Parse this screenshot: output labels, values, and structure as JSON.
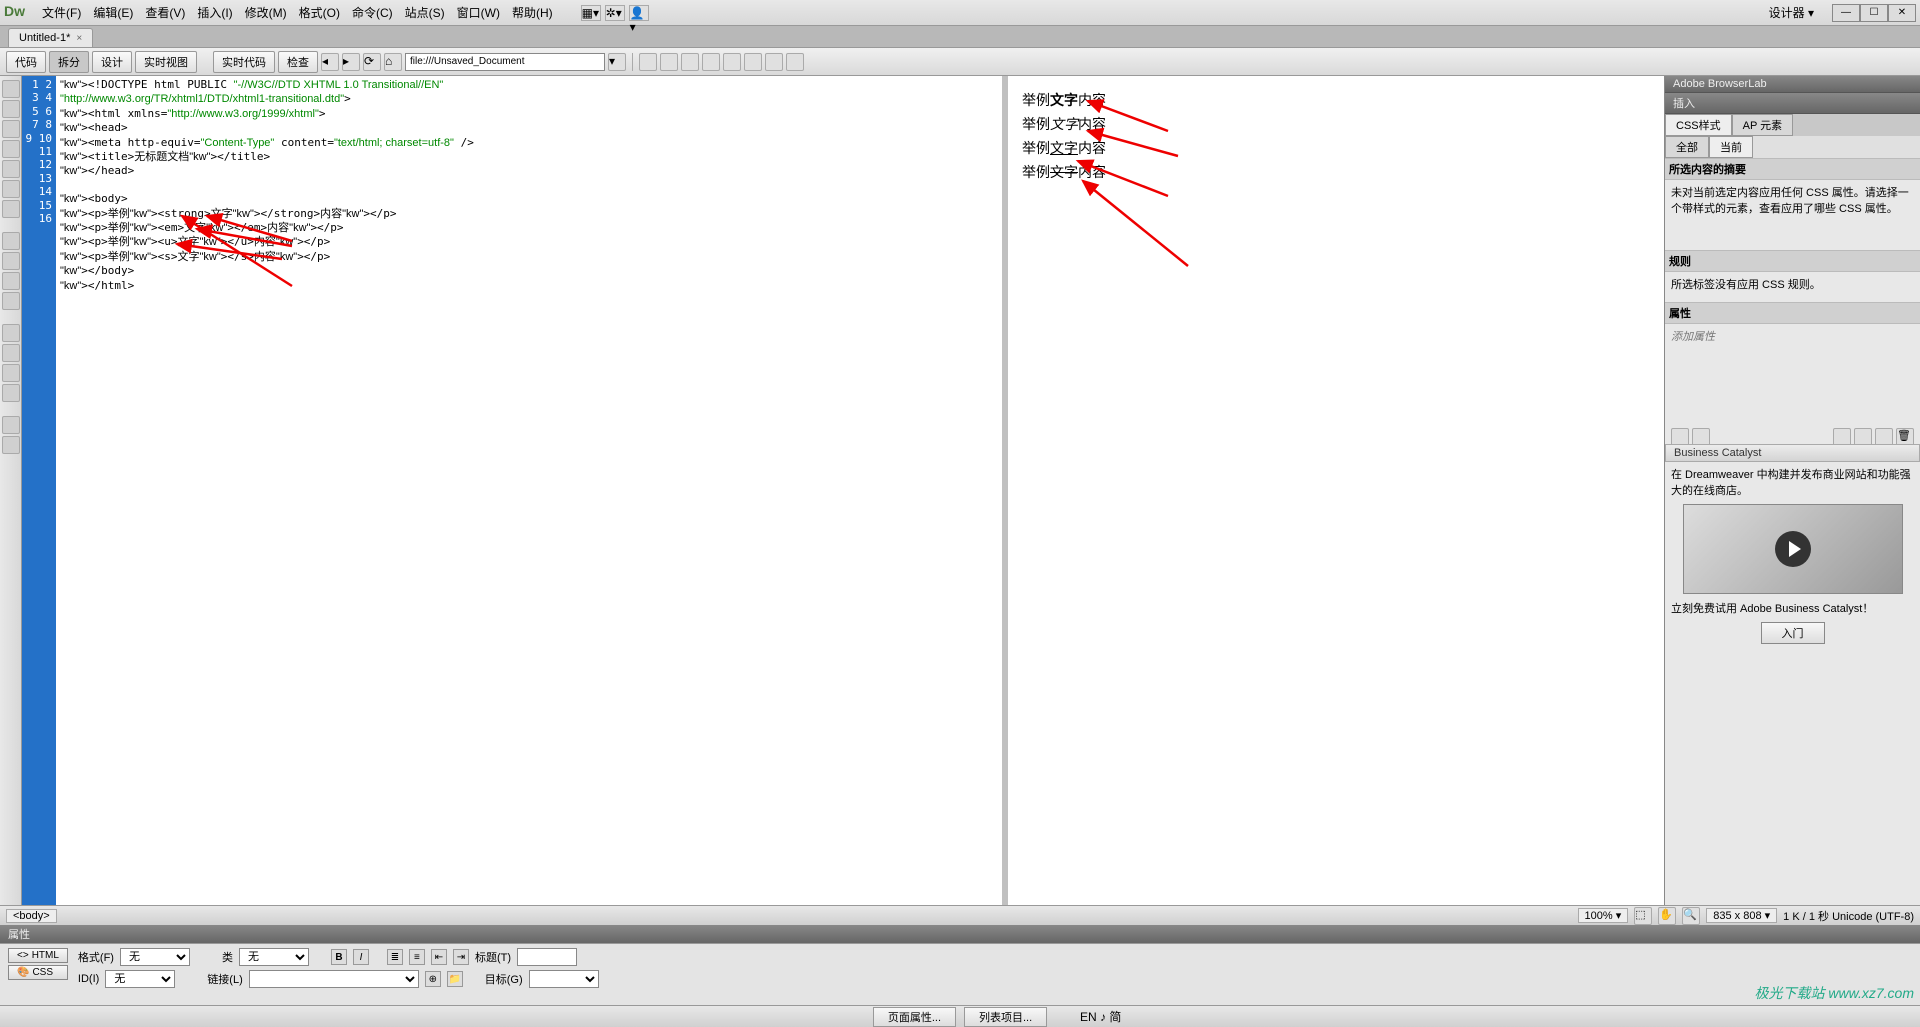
{
  "app": {
    "logo": "Dw",
    "designer": "设计器"
  },
  "menus": [
    "文件(F)",
    "编辑(E)",
    "查看(V)",
    "插入(I)",
    "修改(M)",
    "格式(O)",
    "命令(C)",
    "站点(S)",
    "窗口(W)",
    "帮助(H)"
  ],
  "doctab": {
    "name": "Untitled-1*",
    "close": "×"
  },
  "toolbar": {
    "code": "代码",
    "split": "拆分",
    "design": "设计",
    "live": "实时视图",
    "livecode": "实时代码",
    "inspect": "检查",
    "address_prefix": "file:///",
    "address": "file:///Unsaved_Document"
  },
  "code_lines": [
    "<!DOCTYPE html PUBLIC \"-//W3C//DTD XHTML 1.0 Transitional//EN\"",
    "\"http://www.w3.org/TR/xhtml1/DTD/xhtml1-transitional.dtd\">",
    "<html xmlns=\"http://www.w3.org/1999/xhtml\">",
    "<head>",
    "<meta http-equiv=\"Content-Type\" content=\"text/html; charset=utf-8\" />",
    "<title>无标题文档</title>",
    "</head>",
    "",
    "<body>",
    "<p>举例<strong>文字</strong>内容</p>",
    "<p>举例<em>文字</em>内容</p>",
    "<p>举例<u>文字</u>内容</p>",
    "<p>举例<s>文字</s>内容</p>",
    "</body>",
    "</html>",
    ""
  ],
  "preview": {
    "p1_a": "举例",
    "p1_b": "文字",
    "p1_c": "内容",
    "p2_a": "举例",
    "p2_b": "文字",
    "p2_c": "内容",
    "p3_a": "举例",
    "p3_b": "文字",
    "p3_c": "内容",
    "p4_a": "举例",
    "p4_b": "文字",
    "p4_c": "内容"
  },
  "right": {
    "browserlab": "Adobe BrowserLab",
    "insert": "插入",
    "css_tab1": "CSS样式",
    "css_tab2": "AP 元素",
    "css_sub_all": "全部",
    "css_sub_current": "当前",
    "summary_title": "所选内容的摘要",
    "summary_text": "未对当前选定内容应用任何 CSS 属性。请选择一个带样式的元素，查看应用了哪些 CSS 属性。",
    "rules_title": "规则",
    "rules_text": "所选标签没有应用 CSS 规则。",
    "props_title": "属性",
    "add_prop": "添加属性",
    "bc_title": "Business Catalyst",
    "bc_text": "在 Dreamweaver 中构建并发布商业网站和功能强大的在线商店。",
    "bc_trial": "立刻免费试用 Adobe Business Catalyst！",
    "bc_btn": "入门"
  },
  "tagbar": {
    "body": "<body>",
    "zoom": "100%",
    "dim": "835 x 808",
    "stats": "1 K / 1 秒 Unicode (UTF-8)"
  },
  "props": {
    "title": "属性",
    "html_btn": "HTML",
    "css_btn": "CSS",
    "format": "格式(F)",
    "format_val": "无",
    "id": "ID(I)",
    "id_val": "无",
    "class": "类",
    "class_val": "无",
    "link": "链接(L)",
    "title_lbl": "标题(T)",
    "target_lbl": "目标(G)",
    "page_props": "页面属性...",
    "list_items": "列表项目..."
  },
  "bottom": {
    "ime": "EN ♪ 简"
  },
  "watermark": "极光下载站 www.xz7.com"
}
